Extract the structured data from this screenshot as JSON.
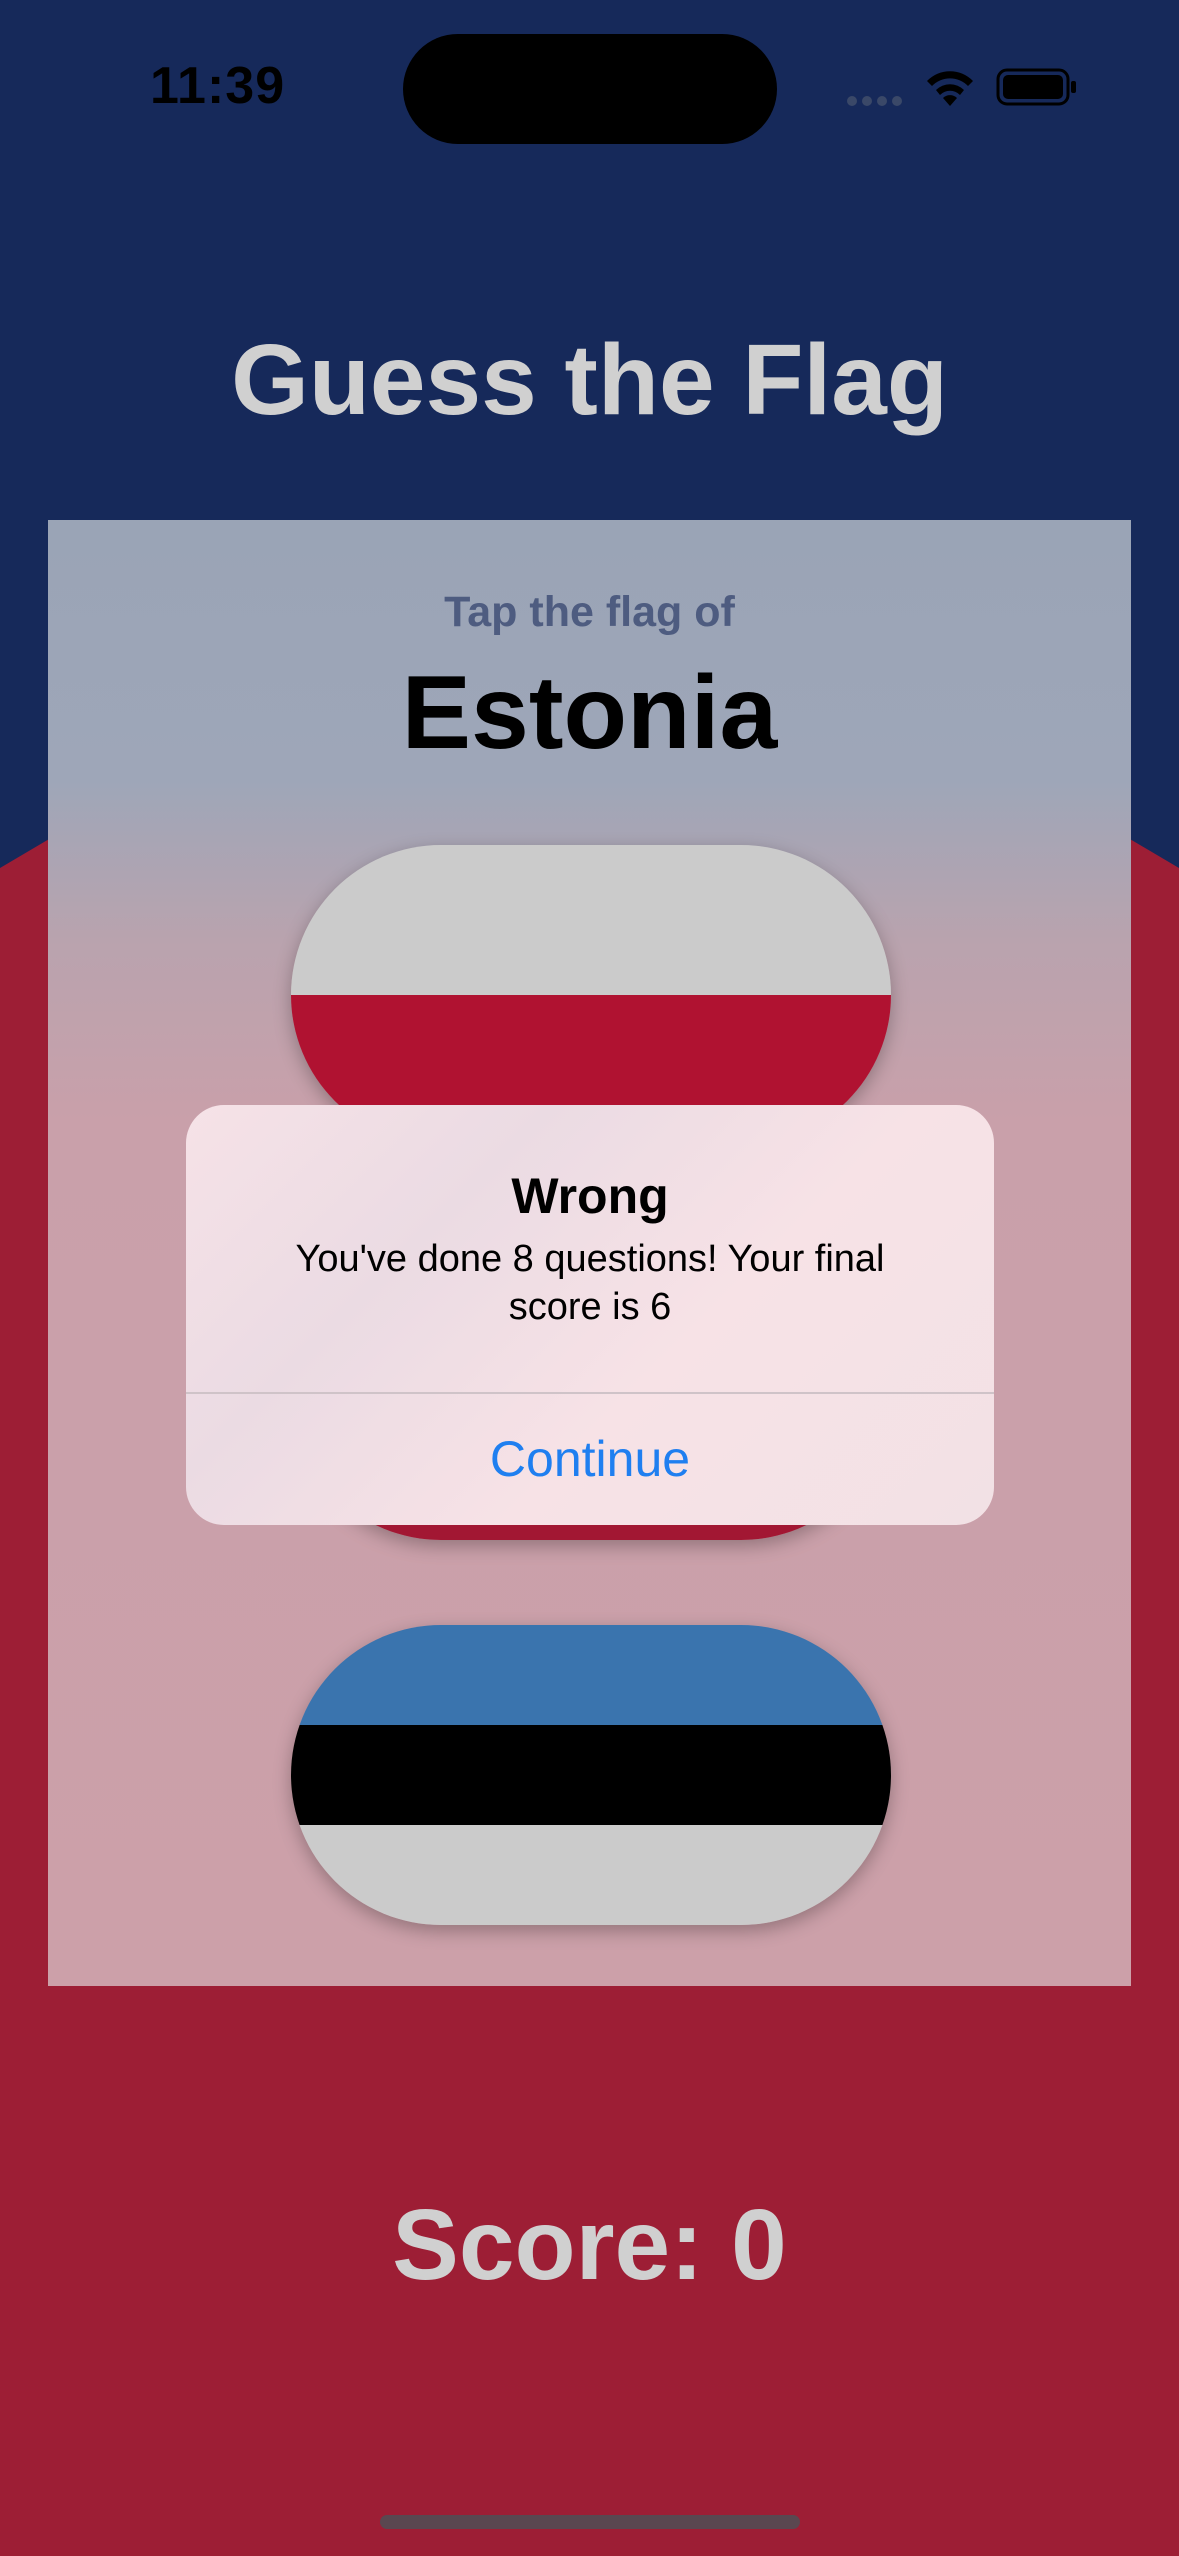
{
  "status_bar": {
    "time": "11:39",
    "icons": [
      "cellular-dots-icon",
      "wifi-icon",
      "battery-icon"
    ]
  },
  "app": {
    "title": "Guess the Flag",
    "prompt_label": "Tap the flag of",
    "country": "Estonia",
    "score_text": "Score: 0"
  },
  "flags": [
    {
      "country": "Poland",
      "stripes": [
        "#cbcbcb",
        "#b01231"
      ]
    },
    {
      "country": "",
      "stripes": [
        "#e8dde0",
        "#a21733"
      ]
    },
    {
      "country": "Estonia",
      "stripes": [
        "#3a74ae",
        "#000000",
        "#cbcbcb"
      ]
    }
  ],
  "alert": {
    "title": "Wrong",
    "message": "You've done 8 questions! Your final score is 6",
    "button_label": "Continue"
  },
  "colors": {
    "top_background": "#16295a",
    "bottom_background": "#9d1e35",
    "accent_blue": "#1f7ff0"
  }
}
